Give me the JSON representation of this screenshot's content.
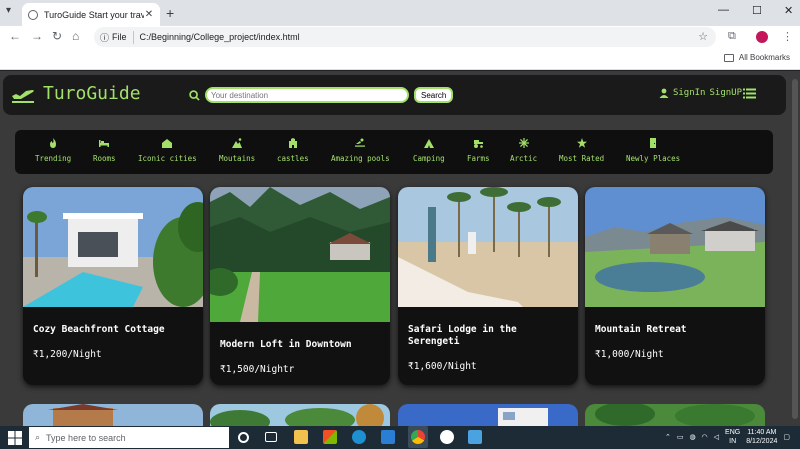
{
  "browser": {
    "tab_title": "TuroGuide Start your travel jou",
    "new_tab": "+",
    "url_chip": "File",
    "url": "C:/Beginning/College_project/index.html",
    "bookmarks_label": "All Bookmarks",
    "minimize": "—",
    "maximize": "☐",
    "close": "✕"
  },
  "header": {
    "logo_text": "TuroGuide",
    "search_placeholder": "Your destination",
    "search_button": "Search",
    "signin": "SignIn",
    "signup": "SignUP"
  },
  "categories": [
    {
      "label": "Trending",
      "icon": "fire-icon"
    },
    {
      "label": "Rooms",
      "icon": "bed-icon"
    },
    {
      "label": "Iconic cities",
      "icon": "city-icon"
    },
    {
      "label": "Moutains",
      "icon": "mountain-icon"
    },
    {
      "label": "castles",
      "icon": "castle-icon"
    },
    {
      "label": "Amazing pools",
      "icon": "pool-icon"
    },
    {
      "label": "Camping",
      "icon": "tent-icon"
    },
    {
      "label": "Farms",
      "icon": "tractor-icon"
    },
    {
      "label": "Arctic",
      "icon": "snowflake-icon"
    },
    {
      "label": "Most Rated",
      "icon": "star-icon"
    },
    {
      "label": "Newly Places",
      "icon": "door-icon"
    }
  ],
  "listings": [
    {
      "name": "Cozy Beachfront Cottage",
      "price": "₹1,200/Night"
    },
    {
      "name": "Modern Loft in Downtown",
      "price": "₹1,500/Nightr"
    },
    {
      "name": "Safari Lodge in the Serengeti",
      "price": "₹1,600/Night"
    },
    {
      "name": "Mountain Retreat",
      "price": "₹1,000/Night"
    }
  ],
  "taskbar": {
    "search_placeholder": "Type here to search",
    "lang_top": "ENG",
    "lang_bottom": "IN",
    "time": "11:40 AM",
    "date": "8/12/2024"
  },
  "colors": {
    "accent": "#a3e06a",
    "header_bg": "#1a1a1a",
    "page_bg": "#3a3a3a"
  }
}
